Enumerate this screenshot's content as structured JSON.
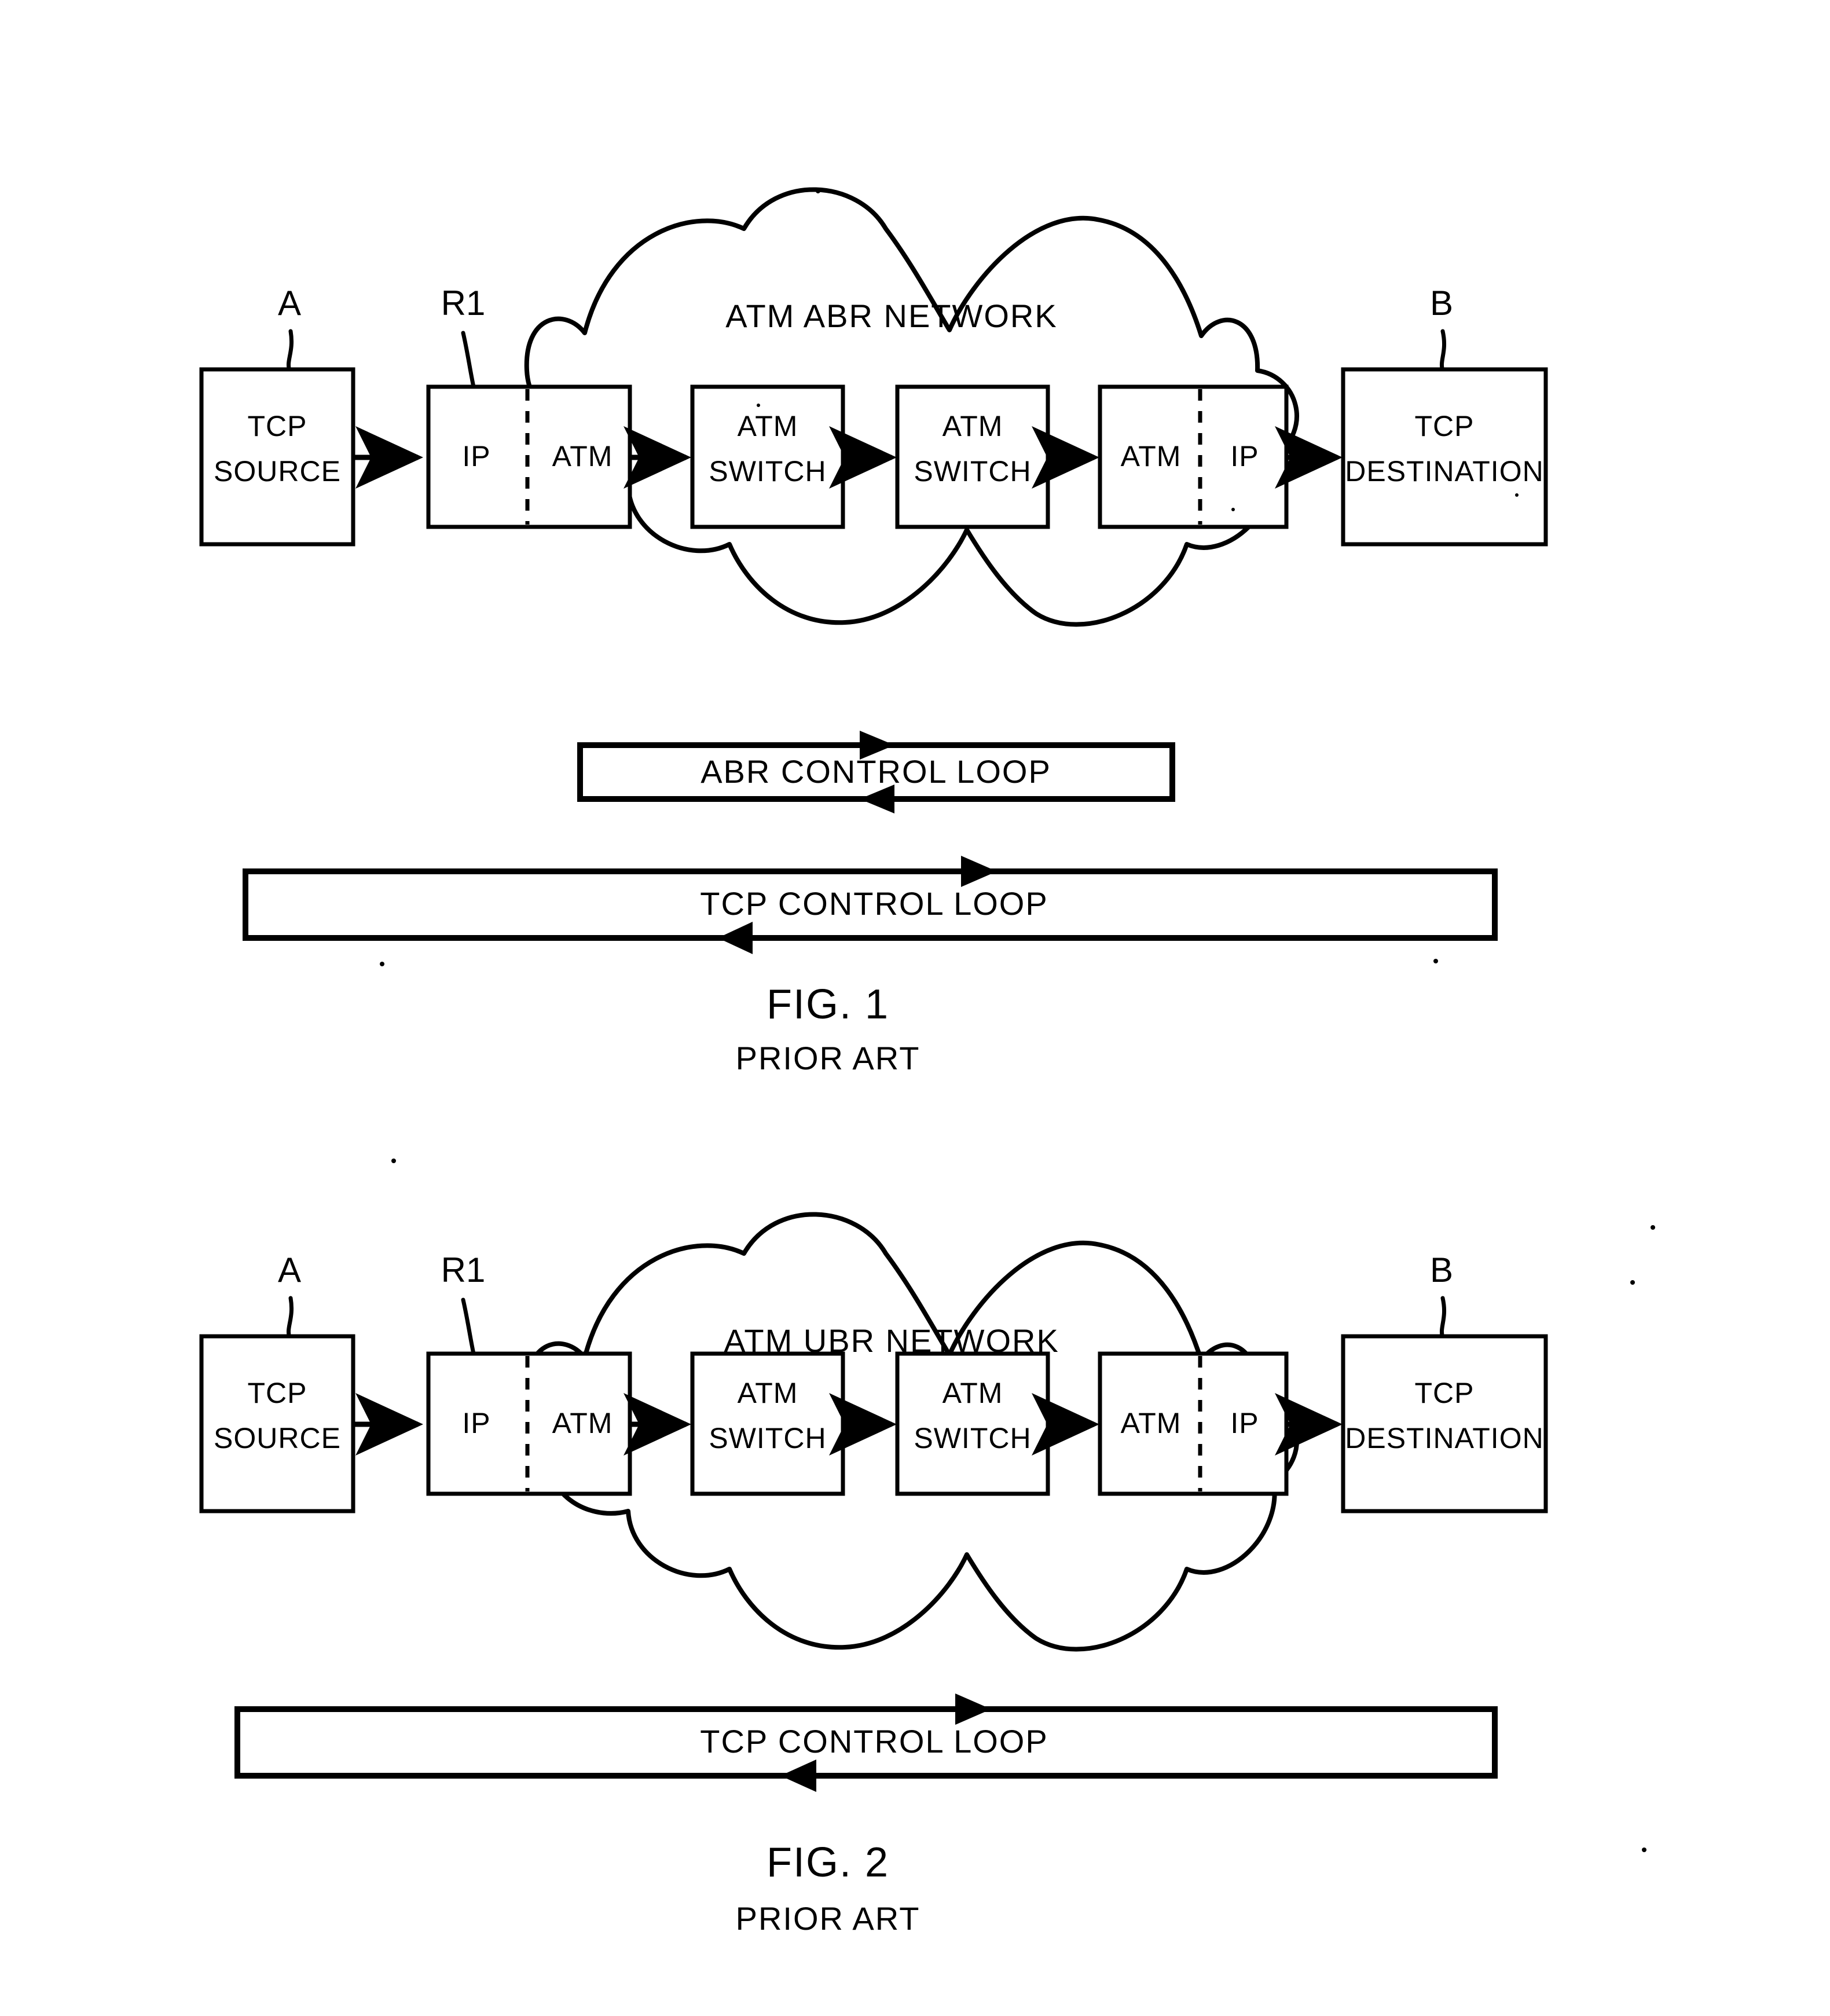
{
  "document": {
    "kind": "patent-figure-sheet",
    "figures": [
      {
        "id": "fig1",
        "caption": "FIG. 1",
        "subcaption": "PRIOR ART",
        "cloud_label": "ATM ABR NETWORK",
        "reference_labels": {
          "source": "A",
          "router": "R1",
          "destination": "B"
        },
        "nodes": [
          {
            "id": "tcp-source",
            "lines": [
              "TCP",
              "SOURCE"
            ],
            "split": false
          },
          {
            "id": "edge-router-ingress",
            "lines": [
              "IP",
              "ATM"
            ],
            "split": true
          },
          {
            "id": "atm-switch-1",
            "lines": [
              "ATM",
              "SWITCH"
            ],
            "split": false
          },
          {
            "id": "atm-switch-2",
            "lines": [
              "ATM",
              "SWITCH"
            ],
            "split": false
          },
          {
            "id": "edge-router-egress",
            "lines": [
              "ATM",
              "IP"
            ],
            "split": true
          },
          {
            "id": "tcp-destination",
            "lines": [
              "TCP",
              "DESTINATION"
            ],
            "split": false
          }
        ],
        "control_loops": [
          {
            "id": "abr-control-loop",
            "label": "ABR CONTROL LOOP"
          },
          {
            "id": "tcp-control-loop",
            "label": "TCP CONTROL LOOP"
          }
        ]
      },
      {
        "id": "fig2",
        "caption": "FIG. 2",
        "subcaption": "PRIOR ART",
        "cloud_label": "ATM UBR NETWORK",
        "reference_labels": {
          "source": "A",
          "router": "R1",
          "destination": "B"
        },
        "nodes": [
          {
            "id": "tcp-source",
            "lines": [
              "TCP",
              "SOURCE"
            ],
            "split": false
          },
          {
            "id": "edge-router-ingress",
            "lines": [
              "IP",
              "ATM"
            ],
            "split": true
          },
          {
            "id": "atm-switch-1",
            "lines": [
              "ATM",
              "SWITCH"
            ],
            "split": false
          },
          {
            "id": "atm-switch-2",
            "lines": [
              "ATM",
              "SWITCH"
            ],
            "split": false
          },
          {
            "id": "edge-router-egress",
            "lines": [
              "ATM",
              "IP"
            ],
            "split": true
          },
          {
            "id": "tcp-destination",
            "lines": [
              "TCP",
              "DESTINATION"
            ],
            "split": false
          }
        ],
        "control_loops": [
          {
            "id": "tcp-control-loop",
            "label": "TCP CONTROL LOOP"
          }
        ]
      }
    ],
    "colors": {
      "ink": "#000000",
      "paper": "#ffffff"
    }
  }
}
